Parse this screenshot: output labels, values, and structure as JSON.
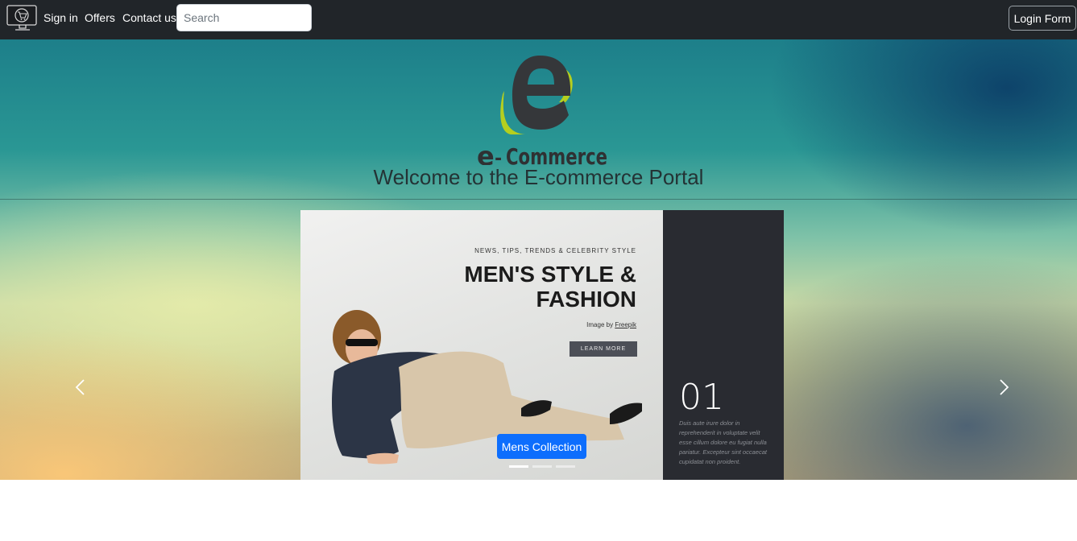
{
  "navbar": {
    "links": [
      "Sign in",
      "Offers",
      "Contact us"
    ],
    "search_placeholder": "Search",
    "login_label": "Login Form"
  },
  "hero": {
    "brand_letter": "e",
    "brand_name": "Commerce",
    "welcome": "Welcome to the E-commerce Portal"
  },
  "slide": {
    "tagline": "NEWS, TIPS, TRENDS & CELEBRITY STYLE",
    "headline_line1": "MEN'S STYLE &",
    "headline_line2": "FASHION",
    "credit_prefix": "Image by",
    "credit_link": "Freepik",
    "cta": "LEARN MORE",
    "number": "01",
    "body": "Duis aute irure dolor in reprehenderit in voluptate velit esse cillum dolore eu fugiat nulla pariatur. Excepteur sint occaecat cupidatat non proident.",
    "caption_button": "Mens Collection"
  },
  "carousel": {
    "indicator_count": 3,
    "active_index": 0
  },
  "colors": {
    "navbar_bg": "#212529",
    "caption_button_bg": "#0d6efd",
    "logo_green": "#b5cf1f",
    "logo_dark": "#2f3133"
  },
  "icons": {
    "nav_logo": "computer-cart-icon",
    "prev": "chevron-left-icon",
    "next": "chevron-right-icon"
  }
}
